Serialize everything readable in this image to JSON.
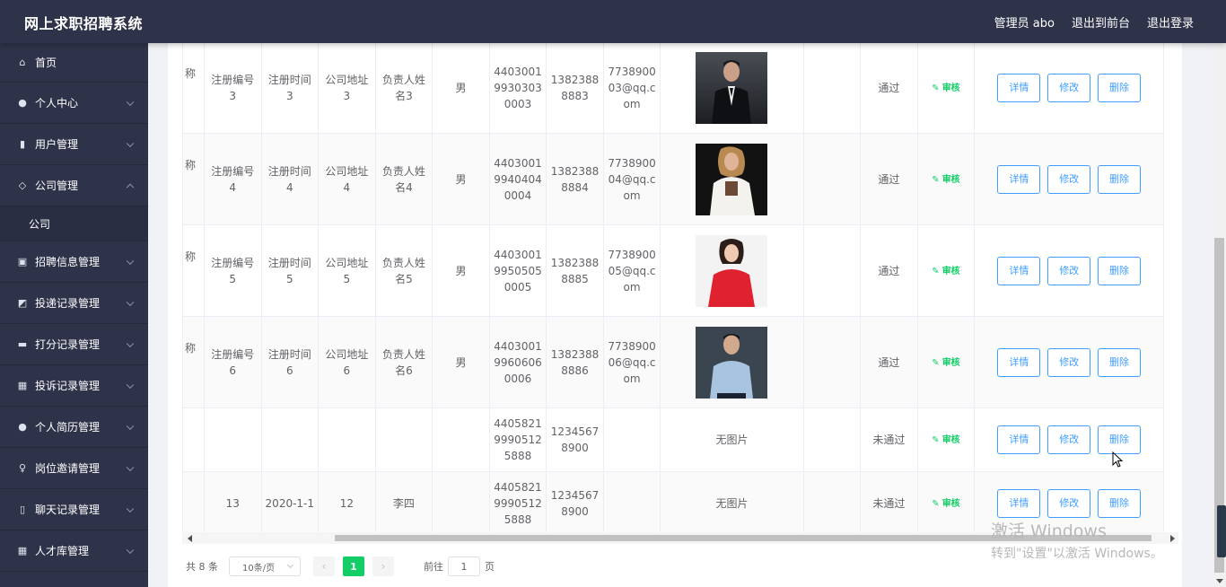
{
  "app": {
    "title": "网上求职招聘系统"
  },
  "header": {
    "user_label": "管理员 abo",
    "front_label": "退出到前台",
    "logout_label": "退出登录"
  },
  "sidebar": {
    "items": [
      {
        "label": "首页",
        "icon": "home-icon"
      },
      {
        "label": "个人中心",
        "icon": "user-icon"
      },
      {
        "label": "用户管理",
        "icon": "bar-chart-icon"
      },
      {
        "label": "公司管理",
        "icon": "bell-icon"
      },
      {
        "label": "招聘信息管理",
        "icon": "clipboard-icon"
      },
      {
        "label": "投递记录管理",
        "icon": "chart-icon"
      },
      {
        "label": "打分记录管理",
        "icon": "monitor-icon"
      },
      {
        "label": "投诉记录管理",
        "icon": "grid-icon"
      },
      {
        "label": "个人简历管理",
        "icon": "pin-icon"
      },
      {
        "label": "岗位邀请管理",
        "icon": "mic-icon"
      },
      {
        "label": "聊天记录管理",
        "icon": "phone-icon"
      },
      {
        "label": "人才库管理",
        "icon": "apps-icon"
      }
    ],
    "sub_company": "公司"
  },
  "table": {
    "rows": [
      {
        "name_cut": "称",
        "reg_no": "注册编号3",
        "reg_time": "注册时间3",
        "address": "公司地址3",
        "contact": "负责人姓名3",
        "gender": "男",
        "id_no": "440300199303030003",
        "phone": "13823888883",
        "email": "773890003@qq.com",
        "photo": "photo-man-black-suit",
        "blank": "",
        "status": "通过",
        "audit": "审核"
      },
      {
        "name_cut": "称",
        "reg_no": "注册编号4",
        "reg_time": "注册时间4",
        "address": "公司地址4",
        "contact": "负责人姓名4",
        "gender": "男",
        "id_no": "440300199404040004",
        "phone": "13823888884",
        "email": "773890004@qq.com",
        "photo": "photo-woman-white-coat",
        "blank": "",
        "status": "通过",
        "audit": "审核"
      },
      {
        "name_cut": "称",
        "reg_no": "注册编号5",
        "reg_time": "注册时间5",
        "address": "公司地址5",
        "contact": "负责人姓名5",
        "gender": "男",
        "id_no": "440300199505050005",
        "phone": "13823888885",
        "email": "773890005@qq.com",
        "photo": "photo-woman-red",
        "blank": "",
        "status": "通过",
        "audit": "审核"
      },
      {
        "name_cut": "称",
        "reg_no": "注册编号6",
        "reg_time": "注册时间6",
        "address": "公司地址6",
        "contact": "负责人姓名6",
        "gender": "男",
        "id_no": "440300199606060006",
        "phone": "13823888886",
        "email": "773890006@qq.com",
        "photo": "photo-man-blue-shirt",
        "blank": "",
        "status": "通过",
        "audit": "审核"
      },
      {
        "name_cut": "",
        "reg_no": "",
        "reg_time": "",
        "address": "",
        "contact": "",
        "gender": "",
        "id_no": "440582199905125888",
        "phone": "12345678900",
        "email": "",
        "photo": "无图片",
        "blank": "",
        "status": "未通过",
        "audit": "审核"
      },
      {
        "name_cut": "",
        "reg_no": "13",
        "reg_time": "2020-1-1",
        "address": "12",
        "contact": "李四",
        "gender": "",
        "id_no": "440582199905125888",
        "phone": "12345678900",
        "email": "",
        "photo": "无图片",
        "blank": "",
        "status": "未通过",
        "audit": "审核"
      }
    ],
    "actions": {
      "detail": "详情",
      "edit": "修改",
      "delete": "删除"
    }
  },
  "pagination": {
    "total": "共 8 条",
    "page_size": "10条/页",
    "current_page": "1",
    "goto_prefix": "前往",
    "goto_value": "1",
    "goto_suffix": "页"
  },
  "watermark": {
    "line1": "激活 Windows",
    "line2": "转到\"设置\"以激活 Windows。"
  }
}
